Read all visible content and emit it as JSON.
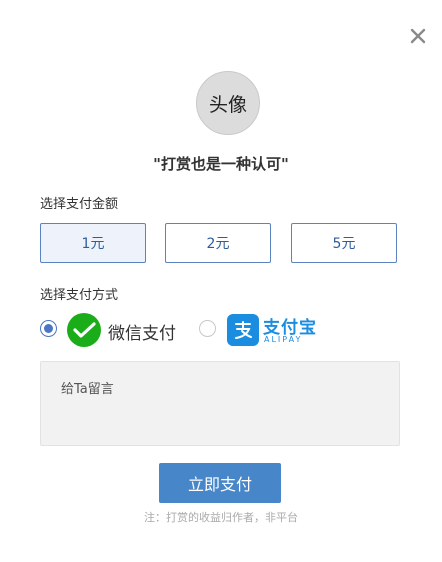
{
  "dialog": {
    "close_icon": "close-icon",
    "avatar_text": "头像",
    "title": "\"打赏也是一种认可\""
  },
  "amount": {
    "label": "选择支付金额",
    "options": [
      "1元",
      "2元",
      "5元"
    ],
    "selected": "1元"
  },
  "payment": {
    "label": "选择支付方式",
    "wechat": {
      "name": "微信支付",
      "selected": true,
      "color": "#1aad19"
    },
    "alipay": {
      "name": "支付宝",
      "sub": "ALIPAY",
      "selected": false,
      "color": "#1b8de0"
    }
  },
  "message": {
    "placeholder": "给Ta留言"
  },
  "pay_button": "立即支付",
  "note": "注：打赏的收益归作者，非平台",
  "colors": {
    "accent": "#4787c9",
    "border_accent": "#5a83c0"
  }
}
